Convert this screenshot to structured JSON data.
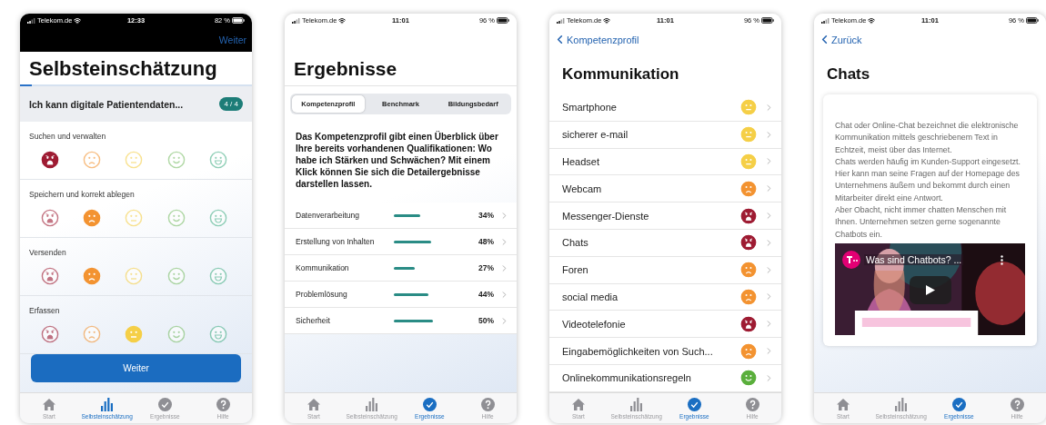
{
  "screens": [
    {
      "kind": "assessment",
      "status_bar": {
        "carrier": "Telekom.de",
        "time": "12:33",
        "battery": "82 %",
        "dark": true
      },
      "nav_action": "Weiter",
      "title": "Selbsteinschätzung",
      "progress": {
        "level": 0.05
      },
      "question": "Ich kann digitale Patientendaten...",
      "counter": "4 / 4",
      "rows": [
        {
          "label": "Suchen und verwalten",
          "faces": [
            {
              "kind": "angry",
              "selected": true
            },
            {
              "kind": "sad",
              "selected": false
            },
            {
              "kind": "neutral",
              "selected": false
            },
            {
              "kind": "smile",
              "selected": false
            },
            {
              "kind": "grin",
              "selected": false
            }
          ]
        },
        {
          "label": "Speichern und korrekt ablegen",
          "faces": [
            {
              "kind": "angry",
              "selected": false
            },
            {
              "kind": "sad",
              "selected": true
            },
            {
              "kind": "neutral",
              "selected": false
            },
            {
              "kind": "smile",
              "selected": false
            },
            {
              "kind": "grin",
              "selected": false
            }
          ]
        },
        {
          "label": "Versenden",
          "faces": [
            {
              "kind": "angry",
              "selected": false
            },
            {
              "kind": "sad",
              "selected": true
            },
            {
              "kind": "neutral",
              "selected": false
            },
            {
              "kind": "smile",
              "selected": false
            },
            {
              "kind": "grin",
              "selected": false
            }
          ]
        },
        {
          "label": "Erfassen",
          "faces": [
            {
              "kind": "angry",
              "selected": false
            },
            {
              "kind": "sad",
              "selected": false
            },
            {
              "kind": "neutral",
              "selected": true
            },
            {
              "kind": "smile",
              "selected": false
            },
            {
              "kind": "grin",
              "selected": false
            }
          ]
        }
      ],
      "button": "Weiter",
      "tab_bar": [
        {
          "kind": "home",
          "label": "Start",
          "selected": false
        },
        {
          "kind": "chart",
          "label": "Selbsteinschätzung",
          "selected": true
        },
        {
          "kind": "check",
          "label": "Ergebnisse",
          "selected": false
        },
        {
          "kind": "help",
          "label": "Hilfe",
          "selected": false
        }
      ]
    },
    {
      "kind": "results",
      "status_bar": {
        "carrier": "Telekom.de",
        "time": "11:01",
        "battery": "96 %",
        "dark": false
      },
      "title": "Ergebnisse",
      "segments": [
        {
          "label": "Kompetenzprofil",
          "selected": true
        },
        {
          "label": "Benchmark",
          "selected": false
        },
        {
          "label": "Bildungsbedarf",
          "selected": false
        }
      ],
      "intro": "Das Kompetenzprofil gibt einen Überblick über Ihre bereits vorhandenen Qualifikationen: Wo habe ich Stärken und Schwächen? Mit einem Klick können Sie sich die Detailergebnisse darstellen lassen.",
      "results": [
        {
          "label": "Datenverarbeitung",
          "value": "34%"
        },
        {
          "label": "Erstellung von Inhalten",
          "value": "48%"
        },
        {
          "label": "Kommunikation",
          "value": "27%"
        },
        {
          "label": "Problemlösung",
          "value": "44%"
        },
        {
          "label": "Sicherheit",
          "value": "50%"
        }
      ],
      "tab_bar": [
        {
          "kind": "home",
          "label": "Start",
          "selected": false
        },
        {
          "kind": "chart",
          "label": "Selbsteinschätzung",
          "selected": false
        },
        {
          "kind": "check",
          "label": "Ergebnisse",
          "selected": true
        },
        {
          "kind": "help",
          "label": "Hilfe",
          "selected": false
        }
      ]
    },
    {
      "kind": "category",
      "status_bar": {
        "carrier": "Telekom.de",
        "time": "11:01",
        "battery": "96 %",
        "dark": false
      },
      "back": "Kompetenzprofil",
      "title": "Kommunikation",
      "items": [
        {
          "label": "Smartphone",
          "kind": "neutral"
        },
        {
          "label": "sicherer e-mail",
          "kind": "neutral"
        },
        {
          "label": "Headset",
          "kind": "neutral"
        },
        {
          "label": "Webcam",
          "kind": "sad"
        },
        {
          "label": "Messenger-Dienste",
          "kind": "angry"
        },
        {
          "label": "Chats",
          "kind": "angry"
        },
        {
          "label": "Foren",
          "kind": "sad"
        },
        {
          "label": "social media",
          "kind": "sad"
        },
        {
          "label": "Videotelefonie",
          "kind": "angry"
        },
        {
          "label": "Eingabemöglichkeiten von Such...",
          "kind": "sad"
        },
        {
          "label": "Onlinekommunikationsregeln",
          "kind": "happy"
        }
      ],
      "tab_bar": [
        {
          "kind": "home",
          "label": "Start",
          "selected": false
        },
        {
          "kind": "chart",
          "label": "Selbsteinschätzung",
          "selected": false
        },
        {
          "kind": "check",
          "label": "Ergebnisse",
          "selected": true
        },
        {
          "kind": "help",
          "label": "Hilfe",
          "selected": false
        }
      ]
    },
    {
      "kind": "detail",
      "status_bar": {
        "carrier": "Telekom.de",
        "time": "11:01",
        "battery": "96 %",
        "dark": false
      },
      "back": "Zurück",
      "title": "Chats",
      "paragraphs": [
        "Chat oder Online-Chat bezeichnet die elektronische Kommunikation mittels geschriebenem Text in Echtzeit, meist über das Internet.",
        "Chats werden häufig im Kunden-Support eingesetzt. Hier kann man seine Fragen auf der Homepage des Unternehmens äußern und bekommt durch einen Mitarbeiter direkt eine Antwort.",
        "Aber Obacht, nicht immer chatten Menschen mit Ihnen. Unternehmen setzen gerne sogenannte Chatbots ein."
      ],
      "video": {
        "kind": "picture",
        "title": "Was sind Chatbots? ..."
      },
      "tab_bar": [
        {
          "kind": "home",
          "label": "Start",
          "selected": false
        },
        {
          "kind": "chart",
          "label": "Selbsteinschätzung",
          "selected": false
        },
        {
          "kind": "check",
          "label": "Ergebnisse",
          "selected": true
        },
        {
          "kind": "help",
          "label": "Hilfe",
          "selected": false
        }
      ]
    }
  ]
}
